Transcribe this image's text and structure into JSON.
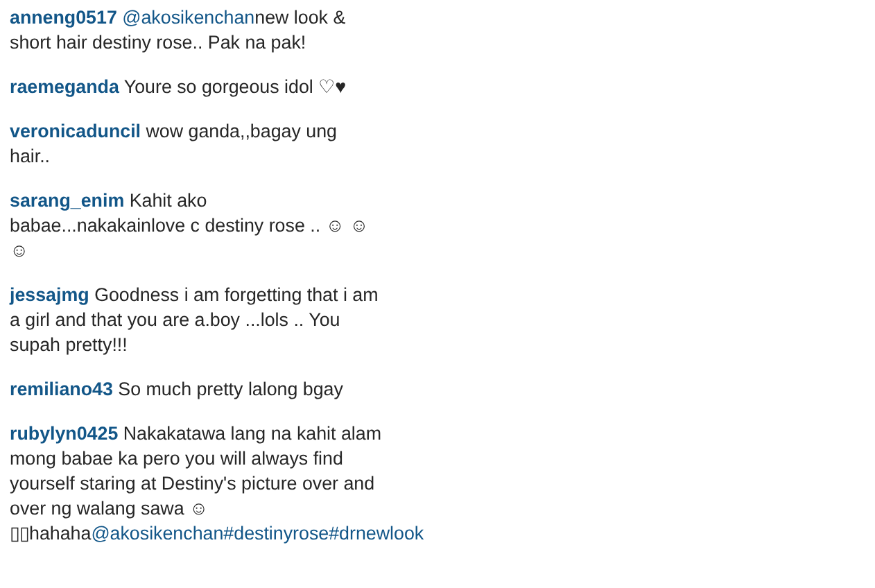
{
  "comments": [
    {
      "username": "anneng0517",
      "parts": [
        {
          "kind": "link",
          "text": "@akosikenchan"
        },
        {
          "kind": "text",
          "text": "new look & short hair destiny rose.. Pak na pak!"
        }
      ]
    },
    {
      "username": "raemeganda",
      "parts": [
        {
          "kind": "text",
          "text": "Youre so gorgeous idol ♡♥"
        }
      ]
    },
    {
      "username": "veronicaduncil",
      "parts": [
        {
          "kind": "text",
          "text": "wow ganda,,bagay ung hair.."
        }
      ]
    },
    {
      "username": "sarang_enim",
      "parts": [
        {
          "kind": "text",
          "text": "Kahit ako babae...nakakainlove c destiny rose .. ☺ ☺☺"
        }
      ]
    },
    {
      "username": "jessajmg",
      "parts": [
        {
          "kind": "text",
          "text": "Goodness i am forgetting that i am a girl and that you are a.boy ...lols .. You supah pretty!!!"
        }
      ]
    },
    {
      "username": "remiliano43",
      "parts": [
        {
          "kind": "text",
          "text": "So much pretty lalong bgay"
        }
      ]
    },
    {
      "username": "rubylyn0425",
      "parts": [
        {
          "kind": "text",
          "text": "Nakakatawa lang na kahit alam mong babae ka pero you will always find yourself staring at Destiny's picture over and over ng walang sawa ☺ ▯▯hahaha"
        },
        {
          "kind": "link",
          "text": "@akosikenchan"
        },
        {
          "kind": "link",
          "text": "#destinyrose"
        },
        {
          "kind": "link",
          "text": "#drnewlook"
        }
      ]
    }
  ]
}
